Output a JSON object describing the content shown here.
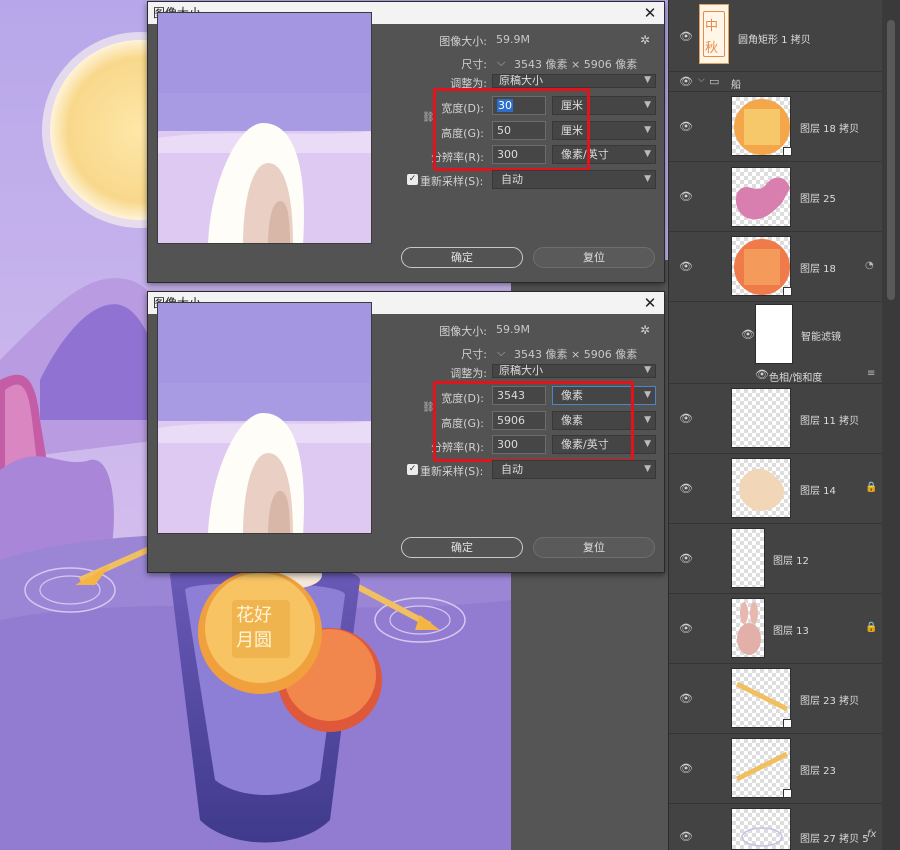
{
  "dialog_top": {
    "title": "图像大小",
    "image_size_label": "图像大小:",
    "image_size_value": "59.9M",
    "dimensions_label": "尺寸:",
    "dimensions_value": "3543 像素 × 5906 像素",
    "fit_to_label": "调整为:",
    "fit_to_value": "原稿大小",
    "width_label": "宽度(D):",
    "width_value": "30",
    "width_unit": "厘米",
    "height_label": "高度(G):",
    "height_value": "50",
    "height_unit": "厘米",
    "resolution_label": "分辨率(R):",
    "resolution_value": "300",
    "resolution_unit": "像素/英寸",
    "resample_label": "重新采样(S):",
    "resample_value": "自动",
    "ok_label": "确定",
    "reset_label": "复位"
  },
  "dialog_bottom": {
    "title": "图像大小",
    "image_size_label": "图像大小:",
    "image_size_value": "59.9M",
    "dimensions_label": "尺寸:",
    "dimensions_value": "3543 像素 × 5906 像素",
    "fit_to_label": "调整为:",
    "fit_to_value": "原稿大小",
    "width_label": "宽度(D):",
    "width_value": "3543",
    "width_unit": "像素",
    "height_label": "高度(G):",
    "height_value": "5906",
    "height_unit": "像素",
    "resolution_label": "分辨率(R):",
    "resolution_value": "300",
    "resolution_unit": "像素/英寸",
    "resample_label": "重新采样(S):",
    "resample_value": "自动",
    "ok_label": "确定",
    "reset_label": "复位"
  },
  "layers": [
    {
      "name": "圆角矩形 1 拷贝"
    },
    {
      "name": "船"
    },
    {
      "name": "图层 18 拷贝"
    },
    {
      "name": "图层 25"
    },
    {
      "name": "图层 18"
    },
    {
      "name": "智能滤镜"
    },
    {
      "name": "色相/饱和度"
    },
    {
      "name": "图层 11 拷贝"
    },
    {
      "name": "图层 14"
    },
    {
      "name": "图层 12"
    },
    {
      "name": "图层 13"
    },
    {
      "name": "图层 23 拷贝"
    },
    {
      "name": "图层 23"
    },
    {
      "name": "图层 27 拷贝 5"
    }
  ],
  "artwork_text": {
    "mooncake_top": "花好",
    "mooncake_bottom": "月圆",
    "tag_top": "中",
    "tag_bottom": "秋"
  },
  "colors": {
    "highlight_box": "#e1141b",
    "selection": "#2c6ecb",
    "panel_bg": "#434343",
    "dialog_bg": "#535353"
  }
}
